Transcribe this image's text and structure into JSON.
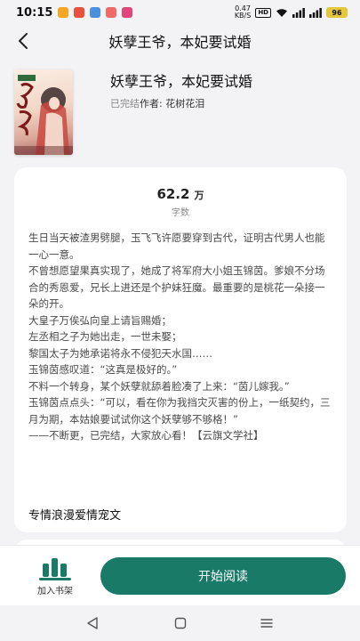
{
  "status_bar": {
    "time": "10:15",
    "speed_value": "0.47",
    "speed_unit": "KB/S",
    "hd_label": "HD",
    "battery": "96",
    "app_icon_colors": [
      "#f5a623",
      "#e8513b",
      "#4a90e2",
      "#f06a6a",
      "#e0457b"
    ]
  },
  "nav": {
    "title": "妖孽王爷，本妃要试婚",
    "back_icon": "chevron-left-icon"
  },
  "book": {
    "title": "妖孽王爷，本妃要试婚",
    "status": "已完结",
    "author_label": "作者: ",
    "author": "花树花泪"
  },
  "stats": {
    "word_count": "62.2万",
    "word_count_unit": "万",
    "word_count_number": "62.2",
    "word_count_label": "字数"
  },
  "synopsis": [
    "生日当天被渣男劈腿，玉飞飞许愿要穿到古代，证明古代男人也能一心一意。",
    "不曾想愿望果真实现了，她成了将军府大小姐玉锦茵。爹娘不分场合的秀恩爱，兄长上进还是个护妹狂魔。最重要的是桃花一朵接一朵的开。",
    "大皇子万俟弘向皇上请旨赐婚；",
    "左丞相之子为她出走，一世未娶；",
    "黎国太子为她承诺将永不侵犯天水国……",
    "玉锦茵感叹道：“这真是极好的。”",
    "不料一个转身，某个妖孽就舔着脸凑了上来：“茵儿嫁我。”",
    "玉锦茵点点头：“可以，看在你为我挡灾灭害的份上，一纸契约，三月为期，本姑娘要试试你这个妖孽够不够格！”",
    "——不断更，已完结，大家放心看！【云旗文学社】"
  ],
  "genre": "专情浪漫爱情宠文",
  "bottom": {
    "shelf_label": "加入书架",
    "read_label": "开始阅读",
    "accent": "#1a7a68"
  },
  "system_nav": {
    "back": "triangle-back-icon",
    "home": "square-home-icon",
    "menu": "menu-lines-icon"
  }
}
